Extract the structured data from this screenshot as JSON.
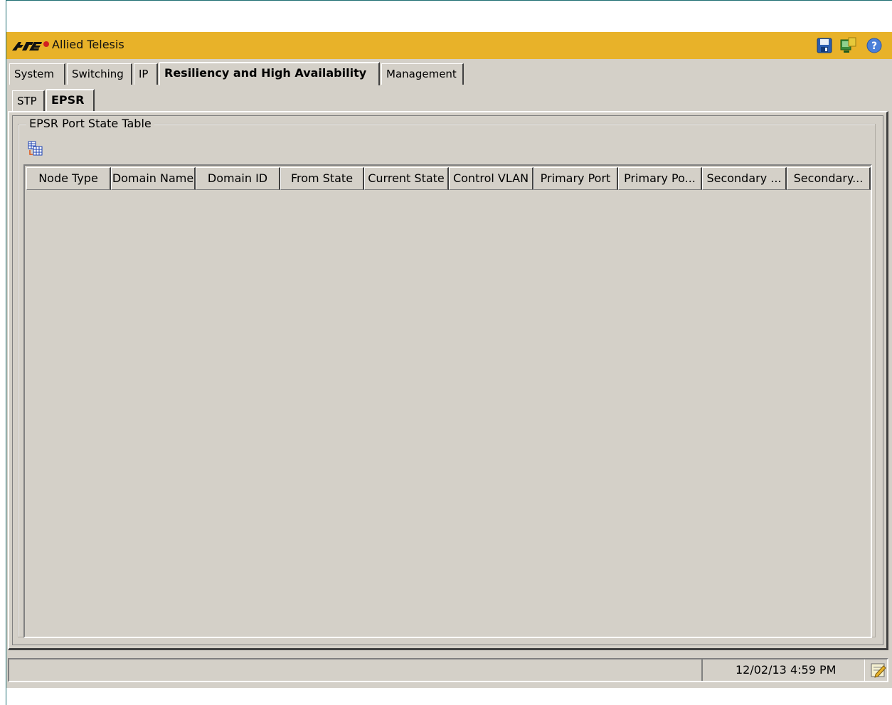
{
  "app": {
    "title": "Allied Telesis",
    "logo_text": "AT"
  },
  "toolbar": {
    "icons": [
      "save-icon",
      "network-monitor-icon",
      "help-icon"
    ]
  },
  "main_tabs": [
    {
      "label": "System",
      "active": false
    },
    {
      "label": "Switching",
      "active": false
    },
    {
      "label": "IP",
      "active": false
    },
    {
      "label": "Resiliency and High Availability",
      "active": true
    },
    {
      "label": "Management",
      "active": false
    }
  ],
  "sub_tabs": [
    {
      "label": "STP",
      "active": false
    },
    {
      "label": "EPSR",
      "active": true
    }
  ],
  "group": {
    "title": "EPSR Port State Table",
    "table_tool_icon": "table-columns-icon"
  },
  "table": {
    "columns": [
      "Node Type",
      "Domain Name",
      "Domain ID",
      "From State",
      "Current State",
      "Control VLAN",
      "Primary Port",
      "Primary Po...",
      "Secondary ...",
      "Secondary..."
    ],
    "rows": []
  },
  "status": {
    "datetime": "12/02/13 4:59 PM",
    "icon": "edit-note-icon"
  },
  "colors": {
    "titlebar": "#e8b229",
    "panel": "#d4d0c8",
    "frame": "#1f6f72"
  }
}
